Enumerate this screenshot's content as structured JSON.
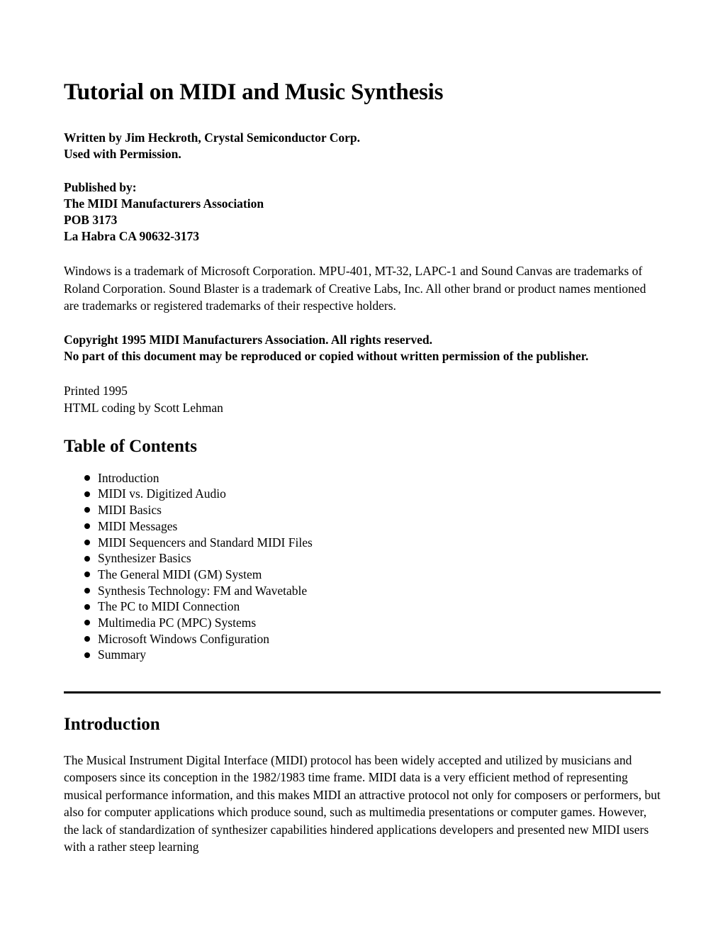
{
  "document": {
    "title": "Tutorial on MIDI and Music Synthesis",
    "byline": {
      "line1": "Written by Jim Heckroth, Crystal Semiconductor Corp.",
      "line2": "Used with Permission."
    },
    "publisher": {
      "label": "Published by:",
      "organization": "The MIDI Manufacturers Association",
      "po_box": "POB 3173",
      "city_state_zip": "La Habra CA 90632-3173"
    },
    "trademark_notice": "Windows is a trademark of Microsoft Corporation. MPU-401, MT-32, LAPC-1 and Sound Canvas are trademarks of Roland Corporation. Sound Blaster is a trademark of Creative Labs, Inc. All other brand or product names mentioned are trademarks or registered trademarks of their respective holders.",
    "copyright": {
      "line1": "Copyright 1995 MIDI Manufacturers Association. All rights reserved.",
      "line2": "No part of this document may be reproduced or copied without written permission of the publisher."
    },
    "printed": {
      "line1": "Printed 1995",
      "line2": "HTML coding by Scott Lehman"
    }
  },
  "table_of_contents": {
    "heading": "Table of Contents",
    "items": [
      {
        "label": "Introduction"
      },
      {
        "label": "MIDI vs. Digitized Audio"
      },
      {
        "label": "MIDI Basics"
      },
      {
        "label": "MIDI Messages"
      },
      {
        "label": "MIDI Sequencers and Standard MIDI Files"
      },
      {
        "label": "Synthesizer Basics"
      },
      {
        "label": "The General MIDI (GM) System"
      },
      {
        "label": "Synthesis Technology: FM and Wavetable"
      },
      {
        "label": "The PC to MIDI Connection"
      },
      {
        "label": "Multimedia PC (MPC) Systems"
      },
      {
        "label": "Microsoft Windows Configuration"
      },
      {
        "label": "Summary"
      }
    ]
  },
  "introduction": {
    "heading": "Introduction",
    "paragraph": "The Musical Instrument Digital Interface (MIDI) protocol has been widely accepted and utilized by musicians and composers since its conception in the 1982/1983 time frame. MIDI data is a very efficient method of representing musical performance information, and this makes MIDI an attractive protocol not only for composers or performers, but also for computer applications which produce sound, such as multimedia presentations or computer games. However, the lack of standardization of synthesizer capabilities hindered applications developers and presented new MIDI users with a rather steep learning"
  },
  "colors": {
    "text": "#000000",
    "background": "#ffffff",
    "rule": "#000000"
  }
}
